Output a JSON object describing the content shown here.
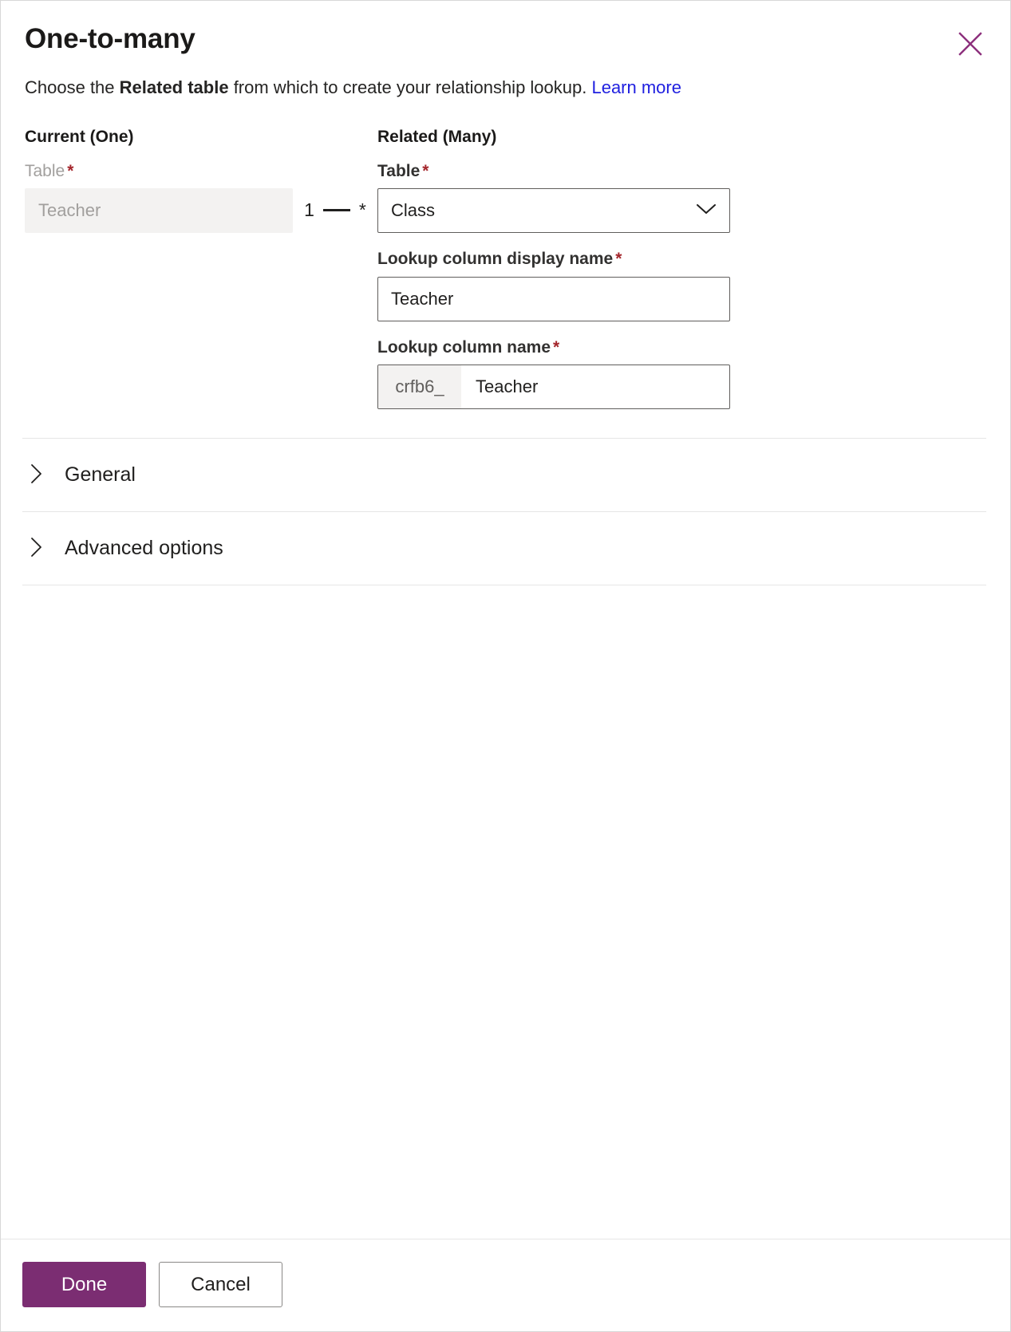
{
  "dialog": {
    "title": "One-to-many",
    "close_icon": "close-icon",
    "subtitle": {
      "prefix": "Choose the ",
      "bold": "Related table",
      "suffix": " from which to create your relationship lookup. ",
      "link": "Learn more"
    }
  },
  "current": {
    "heading": "Current (One)",
    "table_label": "Table",
    "required_marker": "*",
    "table_value": "Teacher"
  },
  "relationship": {
    "one_marker": "1",
    "many_marker": "*"
  },
  "related": {
    "heading": "Related (Many)",
    "table_label": "Table",
    "required_marker": "*",
    "table_value": "Class",
    "table_dropdown_icon": "chevron-down-icon",
    "display_name_label": "Lookup column display name",
    "display_name_value": "Teacher",
    "column_name_label": "Lookup column name",
    "column_name_prefix": "crfb6_",
    "column_name_value": "Teacher"
  },
  "sections": [
    {
      "label": "General",
      "icon": "chevron-right-icon",
      "expanded": false
    },
    {
      "label": "Advanced options",
      "icon": "chevron-right-icon",
      "expanded": false
    }
  ],
  "footer": {
    "done_label": "Done",
    "cancel_label": "Cancel"
  },
  "colors": {
    "primary_button": "#7b2d72",
    "close_icon": "#8c2f7c",
    "link": "#2020e0",
    "required_star": "#a4262c",
    "field_border": "#605e5c",
    "disabled_background": "#f3f2f1",
    "divider": "#e6e6e6"
  }
}
